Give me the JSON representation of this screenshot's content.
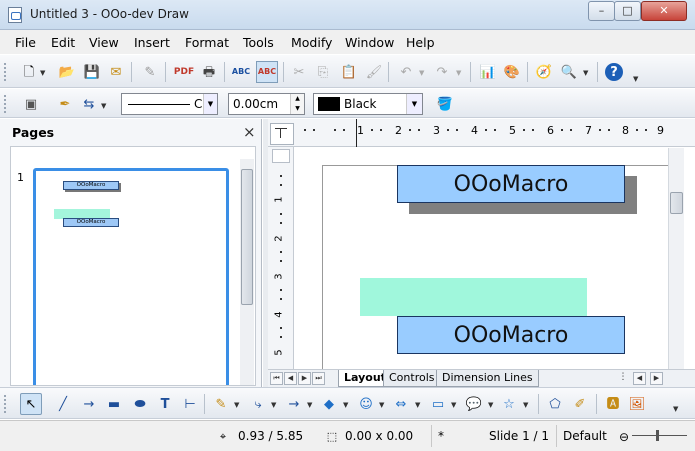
{
  "window": {
    "title": "Untitled 3 - OOo-dev Draw",
    "controls": {
      "minimize": "–",
      "maximize": "□",
      "close": "✕"
    }
  },
  "menu": [
    "File",
    "Edit",
    "View",
    "Insert",
    "Format",
    "Tools",
    "Modify",
    "Window",
    "Help"
  ],
  "line_toolbar": {
    "line_style_value": "C",
    "line_width": "0.00cm",
    "line_color": "Black",
    "line_color_hex": "#000000"
  },
  "pages_pane": {
    "title": "Pages",
    "close": "×",
    "page_number": "1",
    "thumb_label_1": "OOoMacro",
    "thumb_label_2": "OOoMacro"
  },
  "ruler": {
    "h_ticks": [
      "1",
      "2",
      "3",
      "4",
      "5",
      "6",
      "7",
      "8",
      "9"
    ],
    "v_ticks": [
      "1",
      "2",
      "3",
      "4",
      "5"
    ]
  },
  "canvas": {
    "shape1_text": "OOoMacro",
    "shape2_text": "OOoMacro",
    "shape_fill": "#99ccff",
    "aqua_fill": "#a0f7dc",
    "shadow_color": "#808080"
  },
  "tabs": [
    "Layout",
    "Controls",
    "Dimension Lines"
  ],
  "status": {
    "position": "0.93 / 5.85",
    "size": "0.00 x 0.00",
    "modified": "*",
    "slide": "Slide 1 / 1",
    "layout": "Default"
  }
}
